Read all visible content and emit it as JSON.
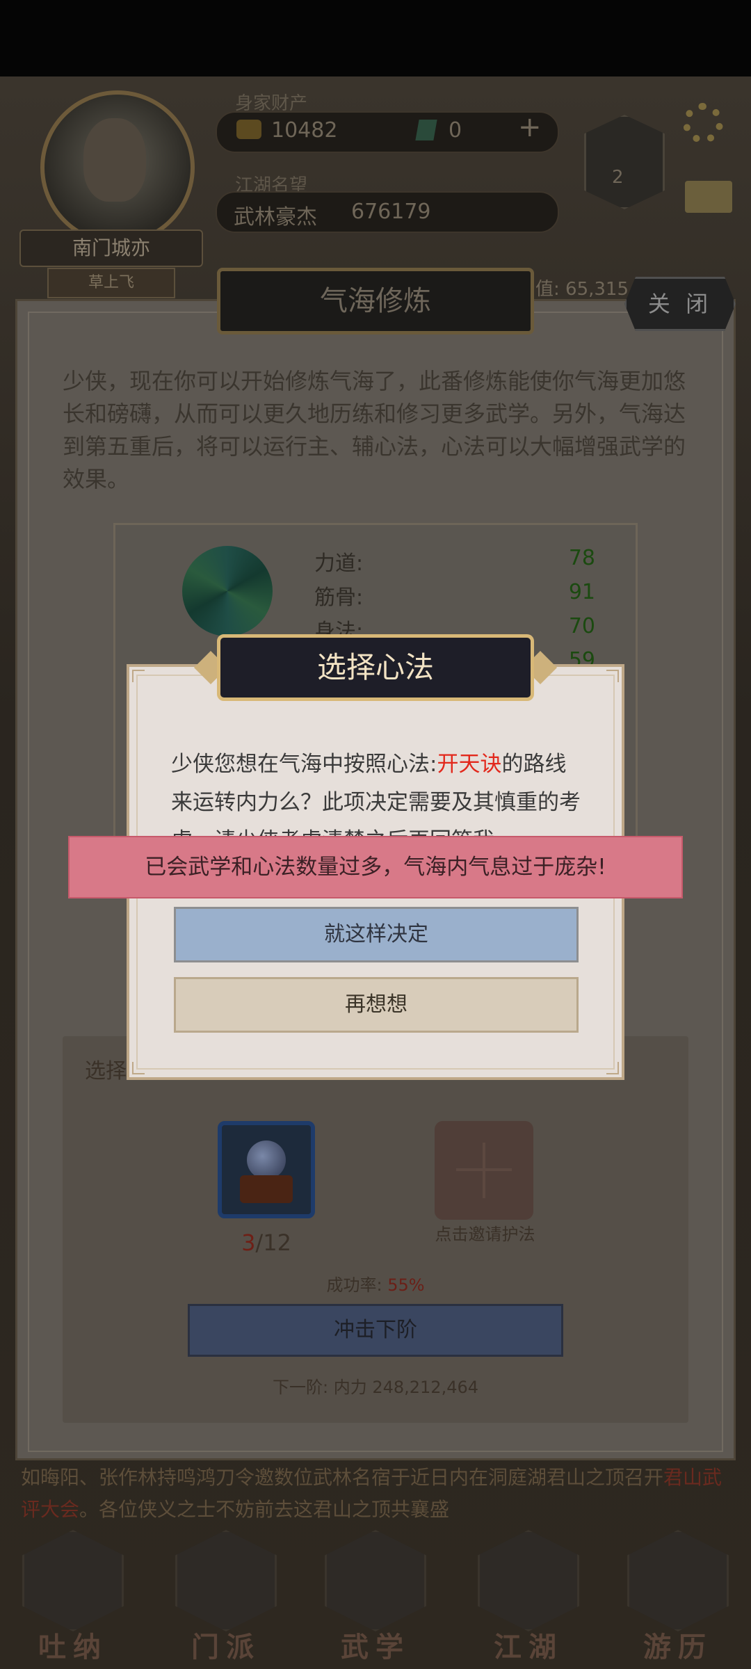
{
  "hud": {
    "wealth_label": "身家财产",
    "coins": "10482",
    "gems": "0",
    "add_symbol": "+",
    "reputation_label": "江湖名望",
    "reputation_rank": "武林豪杰",
    "reputation_value": "676179",
    "badge_number": "2",
    "player_name": "南门城亦",
    "player_title": "草上飞",
    "right_partial": "值: 65,315"
  },
  "main_panel": {
    "title": "气海修炼",
    "close_label": "关 闭",
    "description": "少侠，现在你可以开始修炼气海了，此番修炼能使你气海更加悠长和磅礴，从而可以更久地历练和修习更多武学。另外，气海达到第五重后，将可以运行主、辅心法，心法可以大幅增强武学的效果。",
    "stats": [
      {
        "label": "力道:",
        "value": "78"
      },
      {
        "label": "筋骨:",
        "value": "91"
      },
      {
        "label": "身法:",
        "value": "70"
      },
      {
        "label": "",
        "value": "59"
      }
    ],
    "select_label": "选择",
    "item_count_current": "3",
    "item_count_total": "/12",
    "protector_label": "点击邀请护法",
    "success_rate_label": "成功率: ",
    "success_rate_value": "55%",
    "breakthrough_label": "冲击下阶",
    "next_tier_text": "下一阶:  内力 248,212,464"
  },
  "dialog": {
    "title": "选择心法",
    "text_prefix": "少侠您想在气海中按照心法:",
    "technique_name": "开天诀",
    "text_suffix": "的路线来运转内力么？此项决定需要及其慎重的考虑，请少侠考虑清楚之后再回答我。",
    "confirm_label": "就这样决定",
    "rethink_label": "再想想"
  },
  "toast": {
    "message": "已会武学和心法数量过多，气海内气息过于庞杂!"
  },
  "news": {
    "text_a": "如晦阳、张作林持鸣鸿刀令邀数位武林名宿于近日内在洞庭湖君山之顶召开",
    "highlight": "君山武评大会",
    "text_b": "。各位侠义之士不妨前去这君山之顶共襄盛"
  },
  "nav": [
    {
      "label": "吐纳",
      "icon": "meditation-icon"
    },
    {
      "label": "门派",
      "icon": "sect-icon"
    },
    {
      "label": "武学",
      "icon": "martial-arts-icon"
    },
    {
      "label": "江湖",
      "icon": "jianghu-icon"
    },
    {
      "label": "游历",
      "icon": "travel-icon"
    }
  ],
  "colors": {
    "dialog_title_bg": "#1e1e28",
    "dialog_title_border": "#d8b877",
    "toast_bg": "#d87988",
    "confirm_bg": "#9ab0cc",
    "rethink_bg": "#d8ccba",
    "technique_red": "#e2281c"
  }
}
